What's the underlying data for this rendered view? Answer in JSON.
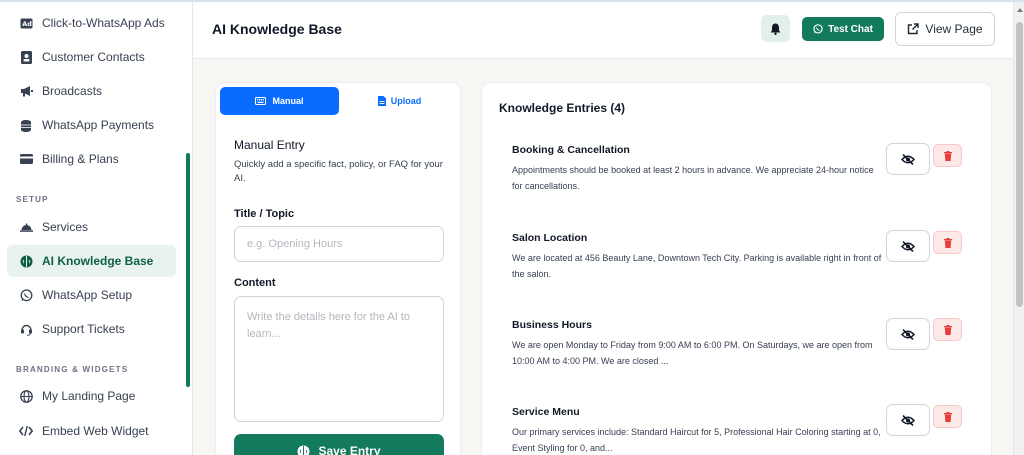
{
  "sidebar": {
    "items": [
      {
        "label": "Click-to-WhatsApp Ads",
        "icon": "ad-icon"
      },
      {
        "label": "Customer Contacts",
        "icon": "contact-card-icon"
      },
      {
        "label": "Broadcasts",
        "icon": "megaphone-icon"
      },
      {
        "label": "WhatsApp Payments",
        "icon": "coins-icon"
      },
      {
        "label": "Billing & Plans",
        "icon": "credit-card-icon"
      }
    ],
    "setup_label": "SETUP",
    "setup_items": [
      {
        "label": "Services",
        "icon": "bell-service-icon"
      },
      {
        "label": "AI Knowledge Base",
        "icon": "brain-icon",
        "active": true
      },
      {
        "label": "WhatsApp Setup",
        "icon": "whatsapp-icon"
      },
      {
        "label": "Support Tickets",
        "icon": "headset-icon"
      }
    ],
    "branding_label": "BRANDING & WIDGETS",
    "branding_items": [
      {
        "label": "My Landing Page",
        "icon": "globe-icon"
      },
      {
        "label": "Embed Web Widget",
        "icon": "code-icon"
      }
    ]
  },
  "header": {
    "title": "AI Knowledge Base",
    "test_chat_label": "Test Chat",
    "view_page_label": "View Page"
  },
  "form": {
    "tab_manual": "Manual",
    "tab_upload": "Upload",
    "title": "Manual Entry",
    "description": "Quickly add a specific fact, policy, or FAQ for your AI.",
    "title_label": "Title / Topic",
    "title_placeholder": "e.g. Opening Hours",
    "content_label": "Content",
    "content_placeholder": "Write the details here for the AI to learn...",
    "save_label": "Save Entry"
  },
  "knowledge": {
    "heading": "Knowledge Entries (4)",
    "entries": [
      {
        "title": "Booking & Cancellation",
        "body": "Appointments should be booked at least 2 hours in advance. We appreciate 24-hour notice for cancellations."
      },
      {
        "title": "Salon Location",
        "body": "We are located at 456 Beauty Lane, Downtown Tech City. Parking is available right in front of the salon."
      },
      {
        "title": "Business Hours",
        "body": "We are open Monday to Friday from 9:00 AM to 6:00 PM. On Saturdays, we are open from 10:00 AM to 4:00 PM. We are closed ..."
      },
      {
        "title": "Service Menu",
        "body": "Our primary services include: Standard Haircut for 5, Professional Hair Coloring starting at 0, Event Styling for 0, and..."
      }
    ]
  },
  "colors": {
    "brand_green": "#137a5e",
    "accent_blue": "#0a6cff",
    "danger": "#e53e3e"
  }
}
